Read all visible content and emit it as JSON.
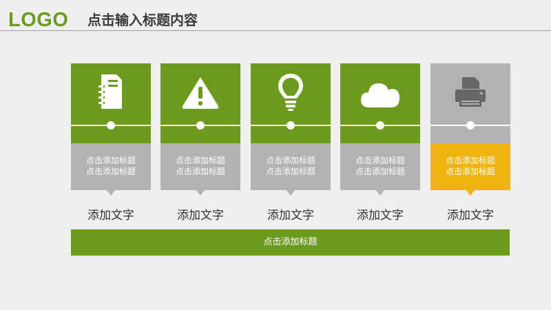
{
  "header": {
    "logo": "LOGO",
    "title": "点击输入标题内容"
  },
  "colors": {
    "accent_green": "#6b9a1f",
    "gray": "#b2b2b2",
    "highlight_yellow": "#efb312",
    "background": "#efefef"
  },
  "cards": [
    {
      "icon": "notebook-icon",
      "subtitle": "点击添加标题\n点击添加标题",
      "caption": "添加文字",
      "active": true
    },
    {
      "icon": "warning-icon",
      "subtitle": "点击添加标题\n点击添加标题",
      "caption": "添加文字",
      "active": true
    },
    {
      "icon": "lightbulb-icon",
      "subtitle": "点击添加标题\n点击添加标题",
      "caption": "添加文字",
      "active": true
    },
    {
      "icon": "cloud-icon",
      "subtitle": "点击添加标题\n点击添加标题",
      "caption": "添加文字",
      "active": true
    },
    {
      "icon": "printer-icon",
      "subtitle": "点击添加标题\n点击添加标题",
      "caption": "添加文字",
      "active": false,
      "highlight": true
    }
  ],
  "footer": {
    "label": "点击添加标题"
  }
}
